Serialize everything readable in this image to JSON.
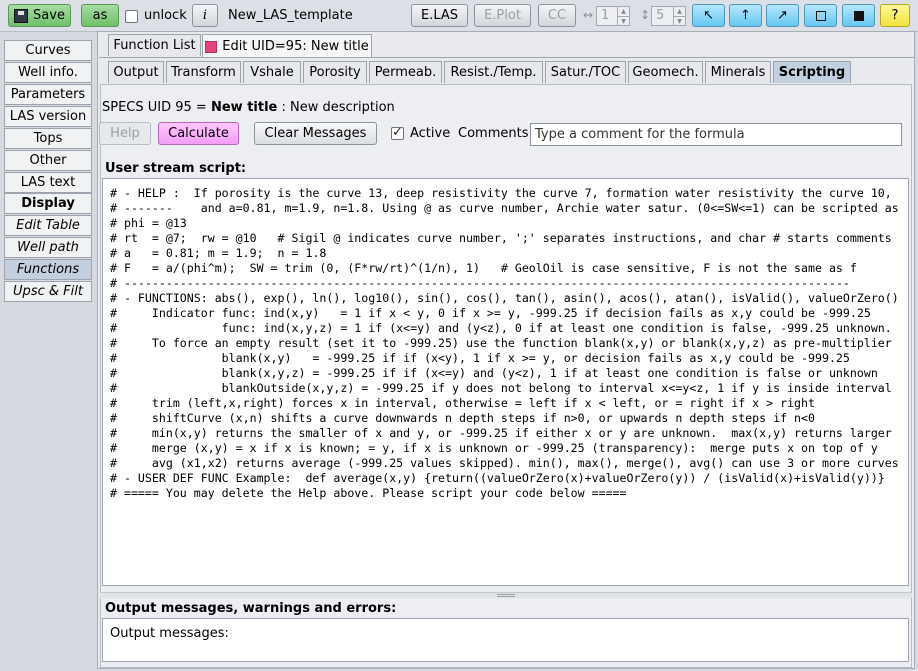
{
  "toolbar": {
    "save_label": "Save",
    "as_label": "as",
    "unlock_label": "unlock",
    "info_label": "i",
    "template_name": "New_LAS_template",
    "elas_label": "E.LAS",
    "eplot_label": "E.Plot",
    "cc_label": "CC",
    "spin1_value": "1",
    "spin2_value": "5",
    "question_label": "?"
  },
  "sidebar": {
    "items": [
      {
        "label": "Curves"
      },
      {
        "label": "Well info."
      },
      {
        "label": "Parameters"
      },
      {
        "label": "LAS version"
      },
      {
        "label": "Tops"
      },
      {
        "label": "Other"
      },
      {
        "label": "LAS text"
      },
      {
        "label": "Display"
      },
      {
        "label": "Edit Table"
      },
      {
        "label": "Well path"
      },
      {
        "label": "Functions"
      },
      {
        "label": "Upsc & Filt"
      }
    ]
  },
  "top_tabs": [
    {
      "label": "Function List"
    },
    {
      "label": "Edit UID=95: New title"
    }
  ],
  "sub_tabs": [
    {
      "label": "Output"
    },
    {
      "label": "Transform"
    },
    {
      "label": "Vshale"
    },
    {
      "label": "Porosity"
    },
    {
      "label": "Permeab."
    },
    {
      "label": "Resist./Temp."
    },
    {
      "label": "Satur./TOC"
    },
    {
      "label": "Geomech."
    },
    {
      "label": "Minerals"
    },
    {
      "label": "Scripting"
    }
  ],
  "specs": {
    "prefix": "SPECS UID 95 = ",
    "title": "New title",
    "separator": " : ",
    "description": "New description"
  },
  "actions": {
    "help_label": "Help",
    "calculate_label": "Calculate",
    "clear_label": "Clear Messages",
    "active_label": "Active",
    "comments_label": "Comments:",
    "comments_value": "Type a comment for the formula"
  },
  "script": {
    "title": "User stream script:",
    "text": "# - HELP :  If porosity is the curve 13, deep resistivity the curve 7, formation water resistivity the curve 10,\n# -------    and a=0.81, m=1.9, n=1.8. Using @ as curve number, Archie water satur. (0<=SW<=1) can be scripted as\n# phi = @13\n# rt  = @7;  rw = @10   # Sigil @ indicates curve number, ';' separates instructions, and char # starts comments\n# a   = 0.81; m = 1.9;  n = 1.8\n# F   = a/(phi^m);  SW = trim (0, (F*rw/rt)^(1/n), 1)   # GeolOil is case sensitive, F is not the same as f\n# --------------------------------------------------------------------------------------------------------\n# - FUNCTIONS: abs(), exp(), ln(), log10(), sin(), cos(), tan(), asin(), acos(), atan(), isValid(), valueOrZero()\n#     Indicator func: ind(x,y)   = 1 if x < y, 0 if x >= y, -999.25 if decision fails as x,y could be -999.25\n#               func: ind(x,y,z) = 1 if (x<=y) and (y<z), 0 if at least one condition is false, -999.25 unknown.\n#     To force an empty result (set it to -999.25) use the function blank(x,y) or blank(x,y,z) as pre-multiplier\n#               blank(x,y)   = -999.25 if if (x<y), 1 if x >= y, or decision fails as x,y could be -999.25\n#               blank(x,y,z) = -999.25 if if (x<=y) and (y<z), 1 if at least one condition is false or unknown\n#               blankOutside(x,y,z) = -999.25 if y does not belong to interval x<=y<z, 1 if y is inside interval\n#     trim (left,x,right) forces x in interval, otherwise = left if x < left, or = right if x > right\n#     shiftCurve (x,n) shifts a curve downwards n depth steps if n>0, or upwards n depth steps if n<0\n#     min(x,y) returns the smaller of x and y, or -999.25 if either x or y are unknown.  max(x,y) returns larger\n#     merge (x,y) = x if x is known; = y, if x is unknown or -999.25 (transparency):  merge puts x on top of y\n#     avg (x1,x2) returns average (-999.25 values skipped). min(), max(), merge(), avg() can use 3 or more curves\n# - USER DEF FUNC Example:  def average(x,y) {return((valueOrZero(x)+valueOrZero(y)) / (isValid(x)+isValid(y))}\n# ===== You may delete the Help above. Please script your code below ====="
  },
  "output": {
    "title": "Output messages, warnings and errors:",
    "text": "Output messages:"
  }
}
